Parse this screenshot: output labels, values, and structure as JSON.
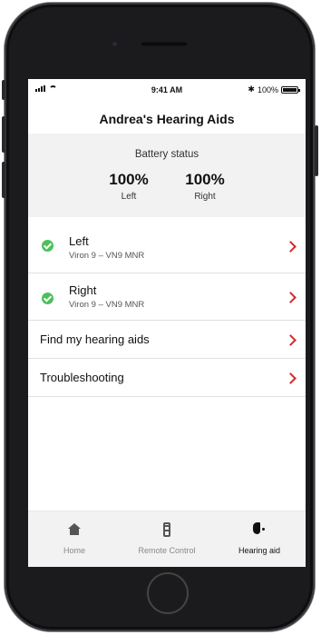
{
  "status_bar": {
    "time": "9:41 AM",
    "battery": "100%"
  },
  "nav": {
    "title": "Andrea's Hearing Aids"
  },
  "battery_status": {
    "title": "Battery status",
    "left": {
      "value": "100%",
      "label": "Left"
    },
    "right": {
      "value": "100%",
      "label": "Right"
    }
  },
  "devices": [
    {
      "name": "Left",
      "model": "Viron 9 – VN9 MNR"
    },
    {
      "name": "Right",
      "model": "Viron 9 – VN9 MNR"
    }
  ],
  "menu": {
    "find": "Find my hearing aids",
    "troubleshooting": "Troubleshooting"
  },
  "tabs": [
    {
      "label": "Home",
      "icon": "home-icon",
      "active": false
    },
    {
      "label": "Remote Control",
      "icon": "remote-control-icon",
      "active": false
    },
    {
      "label": "Hearing aid",
      "icon": "hearing-aid-icon",
      "active": true
    }
  ],
  "colors": {
    "accent_chevron": "#d42a2a",
    "connected_check": "#4cc05a",
    "panel_bg": "#f2f2f2"
  }
}
